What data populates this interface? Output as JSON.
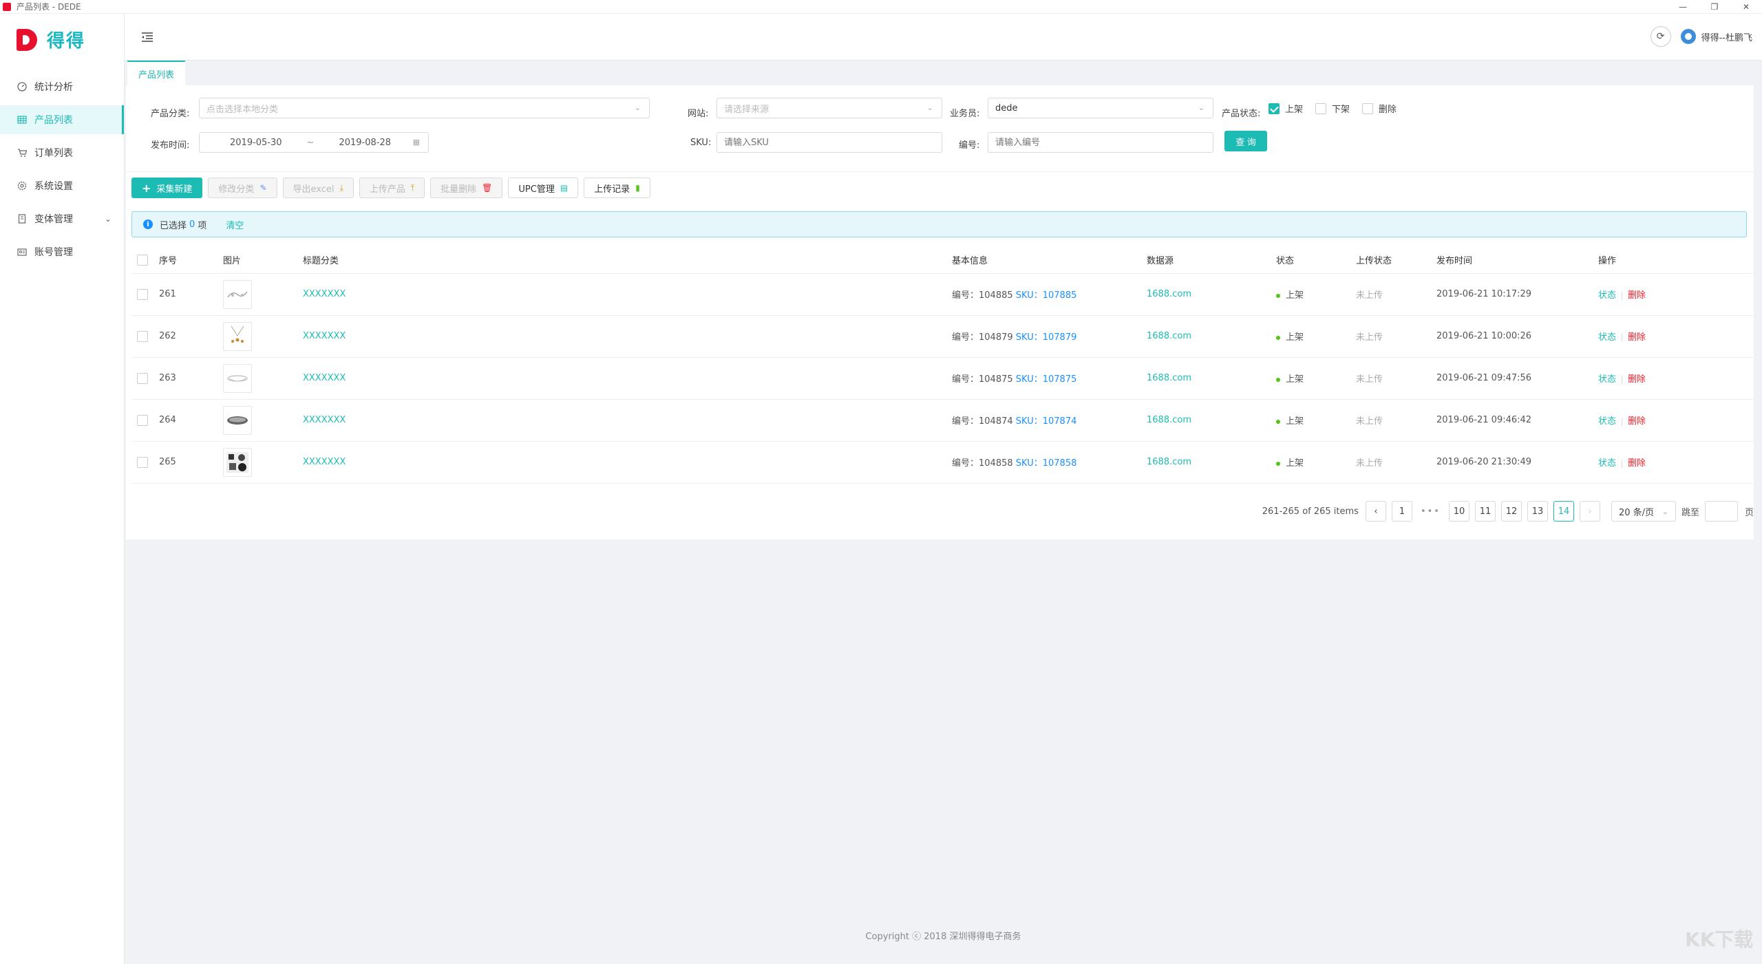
{
  "window": {
    "title": "产品列表 - DEDE",
    "controls": [
      "—",
      "❐",
      "✕"
    ]
  },
  "brand": {
    "name": "得得"
  },
  "menu": [
    {
      "label": "统计分析",
      "icon": "dashboard-icon",
      "active": false
    },
    {
      "label": "产品列表",
      "icon": "grid-icon",
      "active": true
    },
    {
      "label": "订单列表",
      "icon": "cart-icon",
      "active": false
    },
    {
      "label": "系统设置",
      "icon": "gear-icon",
      "active": false
    },
    {
      "label": "变体管理",
      "icon": "book-icon",
      "active": false,
      "expandable": true
    },
    {
      "label": "账号管理",
      "icon": "id-card-icon",
      "active": false
    }
  ],
  "header": {
    "user": "得得--杜鹏飞"
  },
  "tabs": [
    {
      "label": "产品列表"
    }
  ],
  "filters": {
    "category_label": "产品分类:",
    "category_placeholder": "点击选择本地分类",
    "site_label": "网站:",
    "site_placeholder": "请选择来源",
    "salesman_label": "业务员:",
    "salesman_value": "dede",
    "status_label": "产品状态:",
    "status_options": [
      {
        "label": "上架",
        "checked": true
      },
      {
        "label": "下架",
        "checked": false
      },
      {
        "label": "删除",
        "checked": false
      }
    ],
    "date_label": "发布时间:",
    "date_start": "2019-05-30",
    "date_sep": "~",
    "date_end": "2019-08-28",
    "sku_label": "SKU:",
    "sku_placeholder": "请输入SKU",
    "code_label": "编号:",
    "code_placeholder": "请输入编号",
    "query_button": "查 询"
  },
  "toolbar": {
    "new_button": "采集新建",
    "edit_category_button": "修改分类",
    "export_button": "导出excel",
    "upload_button": "上传产品",
    "batch_delete_button": "批量删除",
    "upc_button": "UPC管理",
    "upload_log_button": "上传记录"
  },
  "selection": {
    "prefix": "已选择",
    "count": "0",
    "suffix": "项",
    "clear": "清空"
  },
  "table": {
    "headers": [
      "序号",
      "图片",
      "标题分类",
      "基本信息",
      "数据源",
      "状态",
      "上传状态",
      "发布时间",
      "操作"
    ],
    "rows": [
      {
        "no": "261",
        "title": "XXXXXXX",
        "code_prefix": "编号：104885",
        "sku_label": "SKU：",
        "sku": "107885",
        "source": "1688.com",
        "status": "上架",
        "upload": "未上传",
        "time": "2019-06-21 10:17:29",
        "op_status": "状态",
        "op_delete": "删除"
      },
      {
        "no": "262",
        "title": "XXXXXXX",
        "code_prefix": "编号：104879",
        "sku_label": "SKU：",
        "sku": "107879",
        "source": "1688.com",
        "status": "上架",
        "upload": "未上传",
        "time": "2019-06-21 10:00:26",
        "op_status": "状态",
        "op_delete": "删除"
      },
      {
        "no": "263",
        "title": "XXXXXXX",
        "code_prefix": "编号：104875",
        "sku_label": "SKU：",
        "sku": "107875",
        "source": "1688.com",
        "status": "上架",
        "upload": "未上传",
        "time": "2019-06-21 09:47:56",
        "op_status": "状态",
        "op_delete": "删除"
      },
      {
        "no": "264",
        "title": "XXXXXXX",
        "code_prefix": "编号：104874",
        "sku_label": "SKU：",
        "sku": "107874",
        "source": "1688.com",
        "status": "上架",
        "upload": "未上传",
        "time": "2019-06-21 09:46:42",
        "op_status": "状态",
        "op_delete": "删除"
      },
      {
        "no": "265",
        "title": "XXXXXXX",
        "code_prefix": "编号：104858",
        "sku_label": "SKU：",
        "sku": "107858",
        "source": "1688.com",
        "status": "上架",
        "upload": "未上传",
        "time": "2019-06-20 21:30:49",
        "op_status": "状态",
        "op_delete": "删除"
      }
    ]
  },
  "pagination": {
    "total": "261-265 of 265 items",
    "pages": [
      "1",
      "10",
      "11",
      "12",
      "13",
      "14"
    ],
    "current": "14",
    "page_size": "20 条/页",
    "jump_label": "跳至",
    "jump_suffix": "页"
  },
  "footer": {
    "text": "Copyright ⓒ 2018 深圳得得电子商务"
  },
  "watermark": {
    "text": "KK下载"
  },
  "colors": {
    "accent": "#1cbbb4",
    "danger": "#f5222d",
    "link": "#1890ff",
    "brand": "#e8112d"
  }
}
